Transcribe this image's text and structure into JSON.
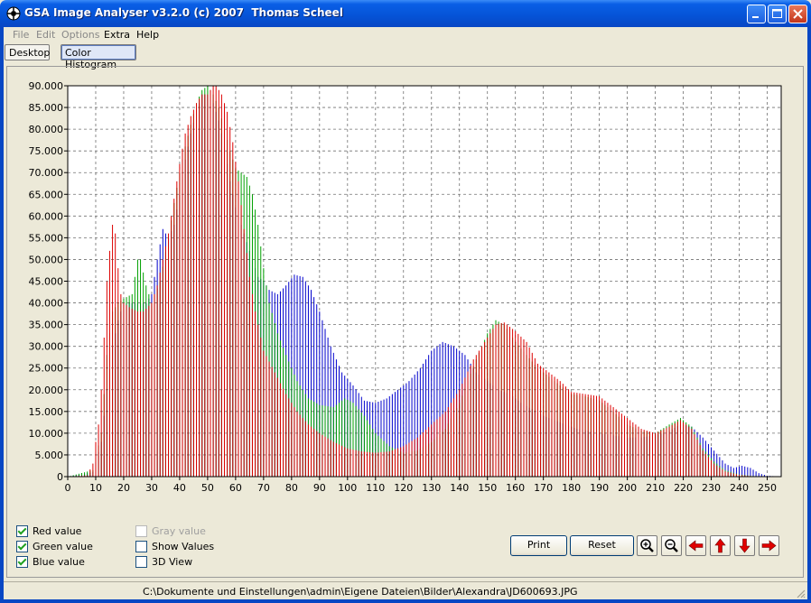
{
  "window": {
    "title": "GSA Image Analyser v3.2.0 (c) 2007  Thomas Scheel",
    "controls": [
      "minimize-icon",
      "maximize-icon",
      "close-icon"
    ]
  },
  "menu": [
    {
      "label": "File",
      "enabled": false
    },
    {
      "label": "Edit",
      "enabled": false
    },
    {
      "label": "Options",
      "enabled": false
    },
    {
      "label": "Extra",
      "enabled": true
    },
    {
      "label": "Help",
      "enabled": true
    }
  ],
  "tabs": [
    {
      "label": "Desktop",
      "active": false
    },
    {
      "label": "Color Histogram",
      "active": true
    }
  ],
  "options": {
    "red": {
      "label": "Red value",
      "checked": true
    },
    "green": {
      "label": "Green value",
      "checked": true
    },
    "blue": {
      "label": "Blue value",
      "checked": true
    },
    "gray": {
      "label": "Gray value",
      "checked": false,
      "enabled": false
    },
    "show_values": {
      "label": "Show Values",
      "checked": false
    },
    "view3d": {
      "label": "3D View",
      "checked": false
    }
  },
  "buttons": {
    "print": "Print",
    "reset": "Reset",
    "icons": [
      "zoom-in-icon",
      "zoom-out-icon",
      "arrow-left-icon",
      "arrow-up-icon",
      "arrow-down-icon",
      "arrow-right-icon"
    ]
  },
  "status": {
    "path": "C:\\Dokumente und Einstellungen\\admin\\Eigene Dateien\\Bilder\\Alexandra\\JD600693.JPG"
  },
  "colors": {
    "red": "#dd0000",
    "green": "#00a000",
    "blue": "#0000cc",
    "title_bar": "#0553d6"
  },
  "chart_data": {
    "type": "bar",
    "title": "",
    "xlabel": "",
    "ylabel": "",
    "xlim": [
      0,
      255
    ],
    "ylim": [
      0,
      90000
    ],
    "x_ticks": [
      0,
      10,
      20,
      30,
      40,
      50,
      60,
      70,
      80,
      90,
      100,
      110,
      120,
      130,
      140,
      150,
      160,
      170,
      180,
      190,
      200,
      210,
      220,
      230,
      240,
      250
    ],
    "y_ticks": [
      "0",
      "5.000",
      "10.000",
      "15.000",
      "20.000",
      "25.000",
      "30.000",
      "35.000",
      "40.000",
      "45.000",
      "50.000",
      "55.000",
      "60.000",
      "65.000",
      "70.000",
      "75.000",
      "80.000",
      "85.000",
      "90.000"
    ],
    "grid": true,
    "series": [
      {
        "name": "Red value",
        "color": "#dd0000",
        "points": [
          [
            0,
            0
          ],
          [
            7,
            300
          ],
          [
            9,
            3000
          ],
          [
            10,
            8000
          ],
          [
            11,
            12000
          ],
          [
            12,
            20000
          ],
          [
            13,
            32000
          ],
          [
            14,
            45000
          ],
          [
            15,
            52000
          ],
          [
            16,
            58000
          ],
          [
            17,
            56000
          ],
          [
            18,
            48000
          ],
          [
            19,
            42000
          ],
          [
            20,
            40000
          ],
          [
            22,
            39000
          ],
          [
            25,
            38000
          ],
          [
            27,
            38000
          ],
          [
            30,
            40000
          ],
          [
            32,
            44000
          ],
          [
            34,
            50000
          ],
          [
            36,
            56000
          ],
          [
            38,
            64000
          ],
          [
            40,
            72000
          ],
          [
            42,
            79000
          ],
          [
            44,
            83000
          ],
          [
            46,
            86000
          ],
          [
            48,
            88000
          ],
          [
            50,
            88000
          ],
          [
            52,
            90000
          ],
          [
            53,
            90000
          ],
          [
            55,
            88000
          ],
          [
            57,
            84000
          ],
          [
            59,
            77000
          ],
          [
            61,
            68000
          ],
          [
            63,
            57000
          ],
          [
            65,
            46000
          ],
          [
            67,
            38000
          ],
          [
            70,
            29000
          ],
          [
            74,
            24000
          ],
          [
            78,
            19000
          ],
          [
            82,
            15000
          ],
          [
            86,
            12000
          ],
          [
            90,
            10000
          ],
          [
            95,
            8000
          ],
          [
            100,
            6500
          ],
          [
            105,
            5800
          ],
          [
            110,
            5500
          ],
          [
            115,
            5800
          ],
          [
            120,
            7000
          ],
          [
            125,
            9000
          ],
          [
            130,
            12000
          ],
          [
            135,
            15000
          ],
          [
            140,
            20000
          ],
          [
            145,
            27000
          ],
          [
            150,
            32000
          ],
          [
            153,
            35000
          ],
          [
            156,
            35500
          ],
          [
            160,
            33500
          ],
          [
            164,
            31000
          ],
          [
            168,
            26000
          ],
          [
            172,
            24000
          ],
          [
            176,
            22000
          ],
          [
            180,
            19500
          ],
          [
            185,
            19000
          ],
          [
            190,
            18500
          ],
          [
            195,
            16000
          ],
          [
            200,
            13500
          ],
          [
            205,
            11000
          ],
          [
            210,
            10000
          ],
          [
            215,
            11500
          ],
          [
            219,
            13000
          ],
          [
            223,
            11000
          ],
          [
            227,
            6000
          ],
          [
            231,
            3000
          ],
          [
            235,
            1200
          ],
          [
            240,
            400
          ],
          [
            245,
            100
          ],
          [
            250,
            30
          ],
          [
            255,
            0
          ]
        ]
      },
      {
        "name": "Green value",
        "color": "#00a000",
        "points": [
          [
            0,
            0
          ],
          [
            9,
            1500
          ],
          [
            12,
            10000
          ],
          [
            14,
            28000
          ],
          [
            16,
            38000
          ],
          [
            18,
            40000
          ],
          [
            20,
            41000
          ],
          [
            23,
            42000
          ],
          [
            25,
            50000
          ],
          [
            26,
            50000
          ],
          [
            28,
            44000
          ],
          [
            30,
            40000
          ],
          [
            33,
            45000
          ],
          [
            36,
            55000
          ],
          [
            38,
            63000
          ],
          [
            40,
            70000
          ],
          [
            42,
            76000
          ],
          [
            44,
            81000
          ],
          [
            46,
            86000
          ],
          [
            48,
            89000
          ],
          [
            50,
            90000
          ],
          [
            52,
            88000
          ],
          [
            54,
            85000
          ],
          [
            56,
            80000
          ],
          [
            58,
            75000
          ],
          [
            60,
            71000
          ],
          [
            62,
            70000
          ],
          [
            64,
            69000
          ],
          [
            66,
            65000
          ],
          [
            68,
            58000
          ],
          [
            70,
            48000
          ],
          [
            72,
            40000
          ],
          [
            75,
            33000
          ],
          [
            78,
            28000
          ],
          [
            82,
            22000
          ],
          [
            86,
            18000
          ],
          [
            90,
            16500
          ],
          [
            95,
            16000
          ],
          [
            99,
            18000
          ],
          [
            102,
            17000
          ],
          [
            106,
            14000
          ],
          [
            110,
            10000
          ],
          [
            115,
            7000
          ],
          [
            120,
            5500
          ],
          [
            125,
            6000
          ],
          [
            130,
            8000
          ],
          [
            135,
            11000
          ],
          [
            140,
            17000
          ],
          [
            143,
            22000
          ],
          [
            146,
            27000
          ],
          [
            150,
            33000
          ],
          [
            153,
            36000
          ],
          [
            156,
            35000
          ],
          [
            160,
            31000
          ],
          [
            164,
            28000
          ],
          [
            168,
            25000
          ],
          [
            172,
            23000
          ],
          [
            176,
            21000
          ],
          [
            180,
            19000
          ],
          [
            185,
            18500
          ],
          [
            190,
            17500
          ],
          [
            195,
            15000
          ],
          [
            200,
            12000
          ],
          [
            205,
            10500
          ],
          [
            210,
            10000
          ],
          [
            215,
            12000
          ],
          [
            219,
            13500
          ],
          [
            223,
            11500
          ],
          [
            227,
            6500
          ],
          [
            231,
            3500
          ],
          [
            235,
            1500
          ],
          [
            240,
            500
          ],
          [
            245,
            150
          ],
          [
            250,
            30
          ],
          [
            255,
            0
          ]
        ]
      },
      {
        "name": "Blue value",
        "color": "#0000cc",
        "points": [
          [
            0,
            0
          ],
          [
            9,
            1000
          ],
          [
            12,
            8000
          ],
          [
            14,
            20000
          ],
          [
            16,
            30000
          ],
          [
            18,
            36000
          ],
          [
            20,
            40000
          ],
          [
            23,
            40000
          ],
          [
            26,
            40000
          ],
          [
            28,
            40000
          ],
          [
            30,
            42000
          ],
          [
            32,
            50000
          ],
          [
            34,
            57000
          ],
          [
            36,
            55000
          ],
          [
            38,
            58000
          ],
          [
            40,
            65000
          ],
          [
            42,
            73000
          ],
          [
            44,
            79000
          ],
          [
            46,
            84000
          ],
          [
            48,
            88000
          ],
          [
            50,
            88000
          ],
          [
            52,
            86000
          ],
          [
            54,
            82000
          ],
          [
            56,
            76000
          ],
          [
            58,
            68000
          ],
          [
            60,
            62000
          ],
          [
            62,
            58000
          ],
          [
            64,
            54000
          ],
          [
            66,
            50000
          ],
          [
            68,
            46000
          ],
          [
            70,
            45000
          ],
          [
            72,
            43000
          ],
          [
            75,
            42000
          ],
          [
            78,
            44000
          ],
          [
            81,
            46500
          ],
          [
            84,
            46000
          ],
          [
            87,
            43000
          ],
          [
            90,
            38000
          ],
          [
            94,
            30000
          ],
          [
            98,
            24000
          ],
          [
            102,
            21000
          ],
          [
            106,
            17500
          ],
          [
            110,
            17000
          ],
          [
            114,
            18000
          ],
          [
            118,
            20000
          ],
          [
            122,
            22000
          ],
          [
            126,
            25000
          ],
          [
            130,
            29000
          ],
          [
            134,
            31000
          ],
          [
            138,
            30000
          ],
          [
            142,
            28000
          ],
          [
            146,
            24000
          ],
          [
            150,
            22000
          ],
          [
            154,
            20000
          ],
          [
            158,
            19000
          ],
          [
            162,
            17000
          ],
          [
            166,
            15500
          ],
          [
            170,
            14000
          ],
          [
            174,
            13000
          ],
          [
            178,
            12000
          ],
          [
            182,
            11000
          ],
          [
            186,
            10500
          ],
          [
            190,
            10000
          ],
          [
            195,
            9500
          ],
          [
            200,
            9000
          ],
          [
            205,
            9000
          ],
          [
            210,
            9500
          ],
          [
            215,
            10500
          ],
          [
            219,
            12000
          ],
          [
            223,
            11500
          ],
          [
            227,
            9000
          ],
          [
            231,
            6000
          ],
          [
            235,
            3000
          ],
          [
            238,
            2000
          ],
          [
            241,
            2500
          ],
          [
            244,
            2000
          ],
          [
            247,
            800
          ],
          [
            250,
            200
          ],
          [
            255,
            0
          ]
        ]
      }
    ]
  }
}
